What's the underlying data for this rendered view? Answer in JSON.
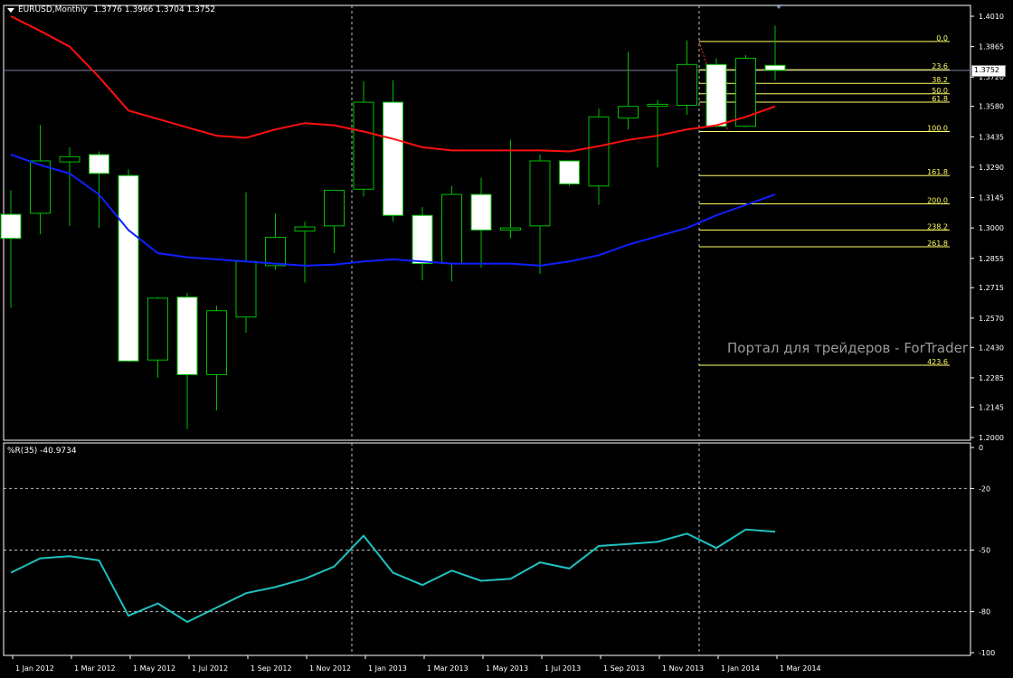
{
  "header": {
    "symbol": "EURUSD,Monthly",
    "ohlc": "1.3776 1.3966 1.3704 1.3752",
    "indicator_label": "%R(35) -40.9734"
  },
  "watermark": "Портал для трейдеров - ForTrader.ru",
  "price_tag": "1.3752",
  "colors": {
    "background": "#000000",
    "bull_candle_fill": "#000000",
    "bear_candle_fill": "#ffffff",
    "candle_outline": "#00c000",
    "ma_red": "#ff1010",
    "ma_blue": "#1020ff",
    "wpr_line": "#20c0c0",
    "fib_line": "#ffff66",
    "grid": "#c0c0c0"
  },
  "chart_data": [
    {
      "type": "candlestick",
      "title": "EURUSD,Monthly",
      "y_ticks": [
        "1.4010",
        "1.3865",
        "1.3720",
        "1.3580",
        "1.3435",
        "1.3290",
        "1.3145",
        "1.3000",
        "1.2855",
        "1.2715",
        "1.2570",
        "1.2430",
        "1.2285",
        "1.2145",
        "1.2000"
      ],
      "x_ticks": [
        "1 Jan 2012",
        "1 Mar 2012",
        "1 May 2012",
        "1 Jul 2012",
        "1 Sep 2012",
        "1 Nov 2012",
        "1 Jan 2013",
        "1 Mar 2013",
        "1 May 2013",
        "1 Jul 2013",
        "1 Sep 2013",
        "1 Nov 2013",
        "1 Jan 2014",
        "1 Mar 2014"
      ],
      "candles": [
        {
          "open": 1.3065,
          "high": 1.318,
          "low": 1.262,
          "close": 1.295
        },
        {
          "open": 1.307,
          "high": 1.349,
          "low": 1.297,
          "close": 1.332
        },
        {
          "open": 1.3315,
          "high": 1.3385,
          "low": 1.301,
          "close": 1.334
        },
        {
          "open": 1.335,
          "high": 1.3365,
          "low": 1.3,
          "close": 1.326
        },
        {
          "open": 1.325,
          "high": 1.328,
          "low": 1.236,
          "close": 1.2365
        },
        {
          "open": 1.237,
          "high": 1.267,
          "low": 1.2285,
          "close": 1.2665
        },
        {
          "open": 1.267,
          "high": 1.269,
          "low": 1.204,
          "close": 1.23
        },
        {
          "open": 1.23,
          "high": 1.263,
          "low": 1.213,
          "close": 1.2605
        },
        {
          "open": 1.2575,
          "high": 1.317,
          "low": 1.25,
          "close": 1.284
        },
        {
          "open": 1.282,
          "high": 1.307,
          "low": 1.28,
          "close": 1.2955
        },
        {
          "open": 1.2985,
          "high": 1.303,
          "low": 1.274,
          "close": 1.3005
        },
        {
          "open": 1.301,
          "high": 1.313,
          "low": 1.288,
          "close": 1.318
        },
        {
          "open": 1.3185,
          "high": 1.37,
          "low": 1.315,
          "close": 1.36
        },
        {
          "open": 1.36,
          "high": 1.3705,
          "low": 1.303,
          "close": 1.306
        },
        {
          "open": 1.306,
          "high": 1.31,
          "low": 1.275,
          "close": 1.283
        },
        {
          "open": 1.283,
          "high": 1.32,
          "low": 1.2745,
          "close": 1.316
        },
        {
          "open": 1.316,
          "high": 1.324,
          "low": 1.281,
          "close": 1.299
        },
        {
          "open": 1.299,
          "high": 1.342,
          "low": 1.295,
          "close": 1.3
        },
        {
          "open": 1.301,
          "high": 1.335,
          "low": 1.278,
          "close": 1.332
        },
        {
          "open": 1.332,
          "high": 1.332,
          "low": 1.32,
          "close": 1.321
        },
        {
          "open": 1.32,
          "high": 1.357,
          "low": 1.311,
          "close": 1.353
        },
        {
          "open": 1.3525,
          "high": 1.384,
          "low": 1.347,
          "close": 1.358
        },
        {
          "open": 1.358,
          "high": 1.361,
          "low": 1.329,
          "close": 1.359
        },
        {
          "open": 1.3585,
          "high": 1.3895,
          "low": 1.354,
          "close": 1.378
        },
        {
          "open": 1.378,
          "high": 1.381,
          "low": 1.348,
          "close": 1.3485
        },
        {
          "open": 1.3485,
          "high": 1.3825,
          "low": 1.348,
          "close": 1.381
        },
        {
          "open": 1.3776,
          "high": 1.3966,
          "low": 1.3704,
          "close": 1.3752
        }
      ],
      "ma_red": [
        1.401,
        1.394,
        1.3865,
        1.372,
        1.356,
        1.352,
        1.348,
        1.344,
        1.343,
        1.347,
        1.35,
        1.349,
        1.346,
        1.3425,
        1.3385,
        1.337,
        1.337,
        1.337,
        1.337,
        1.3365,
        1.339,
        1.342,
        1.344,
        1.347,
        1.349,
        1.353,
        1.358
      ],
      "ma_blue": [
        1.335,
        1.33,
        1.326,
        1.316,
        1.299,
        1.288,
        1.286,
        1.285,
        1.284,
        1.283,
        1.282,
        1.2825,
        1.284,
        1.285,
        1.284,
        1.283,
        1.283,
        1.283,
        1.282,
        1.284,
        1.287,
        1.292,
        1.296,
        1.3,
        1.306,
        1.311,
        1.316
      ],
      "fibonacci": [
        {
          "label": "0.0",
          "price": 1.389
        },
        {
          "label": "23.6",
          "price": 1.3755
        },
        {
          "label": "38.2",
          "price": 1.369
        },
        {
          "label": "50.0",
          "price": 1.364
        },
        {
          "label": "61.8",
          "price": 1.36
        },
        {
          "label": "100.0",
          "price": 1.346
        },
        {
          "label": "161.8",
          "price": 1.325
        },
        {
          "label": "200.0",
          "price": 1.3115
        },
        {
          "label": "238.2",
          "price": 1.299
        },
        {
          "label": "261.8",
          "price": 1.291
        },
        {
          "label": "423.6",
          "price": 1.2345
        }
      ]
    },
    {
      "type": "line",
      "title": "%R(35) -40.9734",
      "y_ticks": [
        "0",
        "-20",
        "-50",
        "-80",
        "-100"
      ],
      "ylim": [
        -100,
        0
      ],
      "values": [
        -61,
        -54,
        -53,
        -55,
        -82,
        -76,
        -85,
        -78,
        -71,
        -68,
        -64,
        -58,
        -43,
        -61,
        -67,
        -60,
        -65,
        -64,
        -56,
        -59,
        -48,
        -47,
        -46,
        -42,
        -49,
        -40,
        -41
      ]
    }
  ]
}
